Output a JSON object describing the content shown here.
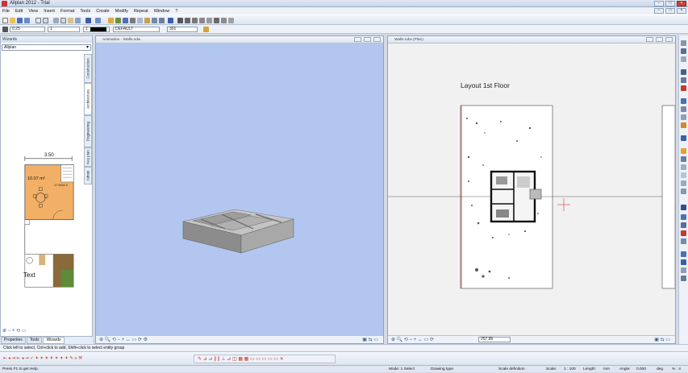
{
  "app": {
    "title": "Allplan 2012 - Trial"
  },
  "menu": [
    "File",
    "Edit",
    "View",
    "Insert",
    "Format",
    "Tools",
    "Create",
    "Modify",
    "Repeat",
    "Window",
    "?"
  ],
  "format_bar": {
    "pen": "0.25",
    "line": "1",
    "color": "1",
    "layer": "DEFAULT",
    "pattern": "301"
  },
  "left_panel": {
    "header": "Wizards",
    "combo_value": "Allplan",
    "vtabs": [
      "Construction",
      "Architecture",
      "Engineering",
      "Key plan",
      "Admin"
    ],
    "thumb": {
      "dimension": "3.50",
      "room_area": "10.07 m²",
      "room_label": "17.5/24.5",
      "text_label": "Text"
    },
    "tabs": [
      "Properties",
      "Tools",
      "Wizards"
    ]
  },
  "viewport_animation": {
    "title": "Animation - Walls.ndw"
  },
  "viewport_plan": {
    "title": "Walls.ndw (Plan)",
    "layout_title": "Layout 1st Floor",
    "scale_field": "257.85"
  },
  "prompt": "Click left to select, Ctrl+click to add, Shift+click to select entity group",
  "status": {
    "help": "Press F1 to get Help.",
    "mode": "Mode: 1 Select",
    "drawing_type": "Drawing type",
    "scale_def": "Scale definition",
    "scale_label": "Scale:",
    "scale_value": "1 : 100",
    "length_label": "Length:",
    "length_unit": "mm",
    "angle_label": "Angle:",
    "angle_value": "0.000",
    "angle_unit": "deg",
    "percent": "% : 4"
  },
  "colors": {
    "animation_bg": "#b3c6ef",
    "room_fill": "#f2b066",
    "accent_red": "#d23a2a"
  }
}
